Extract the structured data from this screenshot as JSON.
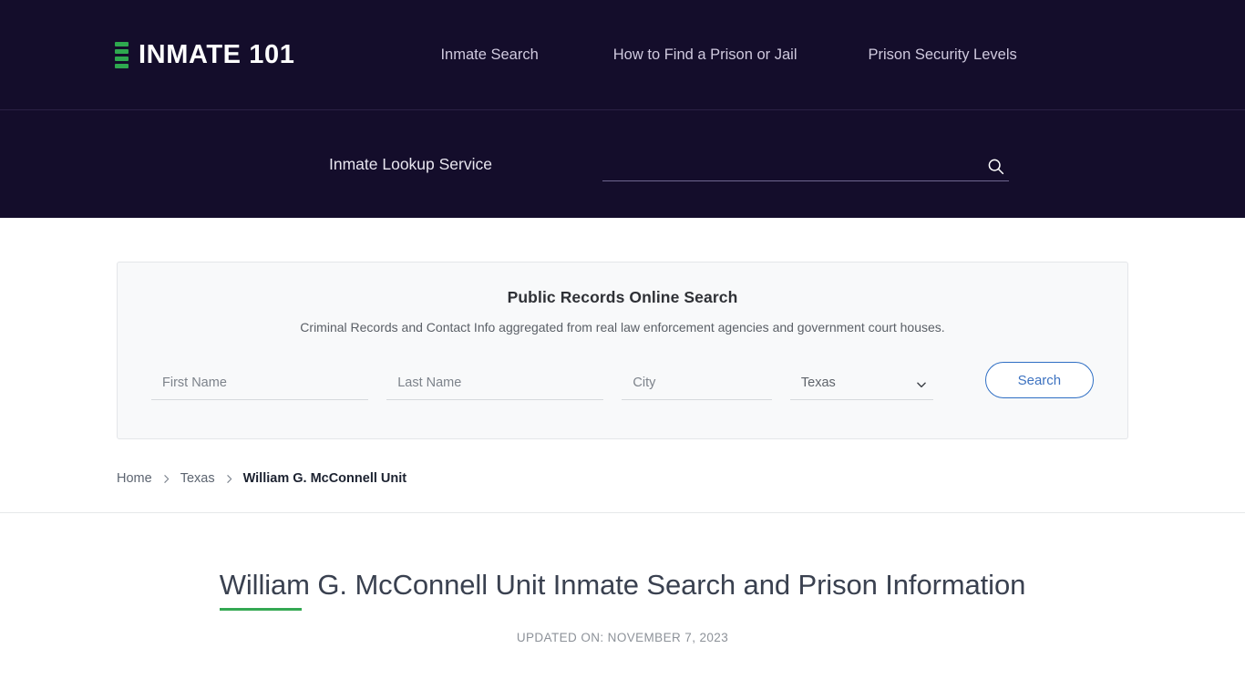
{
  "header": {
    "brand": {
      "logo_icon": "bars-logo-icon",
      "text": "INMATE 101",
      "accent_color": "#2ea84f"
    },
    "nav": [
      {
        "label": "Inmate Search"
      },
      {
        "label": "How to Find a Prison or Jail"
      },
      {
        "label": "Prison Security Levels"
      }
    ],
    "background_color": "#140d2b"
  },
  "lookup": {
    "label": "Inmate Lookup Service",
    "input_value": "",
    "input_placeholder": "",
    "search_icon": "magnifier-icon"
  },
  "panel": {
    "title": "Public Records Online Search",
    "subtitle": "Criminal Records and Contact Info aggregated from real law enforcement agencies and government court houses.",
    "fields": {
      "first_name": {
        "placeholder": "First Name",
        "value": ""
      },
      "last_name": {
        "placeholder": "Last Name",
        "value": ""
      },
      "city": {
        "placeholder": "City",
        "value": ""
      },
      "state": {
        "selected": "Texas",
        "icon": "chevron-down-icon"
      }
    },
    "search_button": "Search",
    "accent_color": "#3d72c0",
    "background_color": "#f8f9fa"
  },
  "breadcrumb": {
    "items": [
      {
        "label": "Home"
      },
      {
        "label": "Texas"
      }
    ],
    "current": "William G. McConnell Unit",
    "separator_icon": "chevron-right-icon"
  },
  "article": {
    "title": "William G. McConnell Unit Inmate Search and Prison Information",
    "updated": "UPDATED ON: NOVEMBER 7, 2023",
    "underline_color": "#34a853"
  }
}
